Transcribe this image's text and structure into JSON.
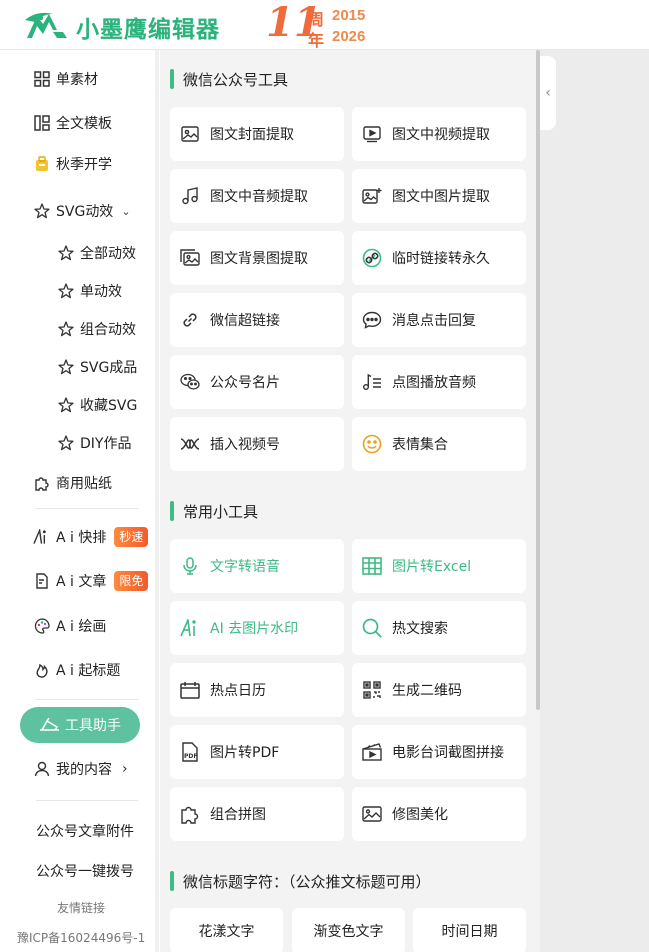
{
  "brand": {
    "name": "小墨鹰编辑器",
    "accent": "#2bb37c"
  },
  "anniversary": {
    "number": "11",
    "zhou": "周",
    "nian": "年",
    "year_start": "2015",
    "year_end": "2026"
  },
  "sidebar": {
    "items": [
      {
        "label": "单素材",
        "icon": "grid-icon"
      },
      {
        "label": "全文模板",
        "icon": "template-icon"
      },
      {
        "label": "秋季开学",
        "icon": "bag-icon"
      },
      {
        "label": "SVG动效",
        "icon": "star-icon"
      }
    ],
    "svg_sub": [
      {
        "label": "全部动效"
      },
      {
        "label": "单动效"
      },
      {
        "label": "组合动效"
      },
      {
        "label": "SVG成品"
      },
      {
        "label": "收藏SVG"
      },
      {
        "label": "DIY作品"
      }
    ],
    "sticker": {
      "label": "商用贴纸"
    },
    "ai_items": [
      {
        "label": "A i 快排",
        "badge": "秒速"
      },
      {
        "label": "A i 文章",
        "badge": "限免"
      },
      {
        "label": "A i 绘画",
        "badge": ""
      },
      {
        "label": "A i 起标题",
        "badge": ""
      }
    ],
    "tool_helper": "工具助手",
    "my_content": "我的内容",
    "attachment": "公众号文章附件",
    "dial": "公众号一键拨号",
    "friend_links": "友情链接",
    "icp": "豫ICP备16024496号-1"
  },
  "main": {
    "section1": {
      "title": "微信公众号工具",
      "cards": [
        {
          "label": "图文封面提取",
          "icon": "image-icon"
        },
        {
          "label": "图文中视频提取",
          "icon": "video-icon"
        },
        {
          "label": "图文中音频提取",
          "icon": "music-icon"
        },
        {
          "label": "图文中图片提取",
          "icon": "image-plus-icon"
        },
        {
          "label": "图文背景图提取",
          "icon": "images-icon"
        },
        {
          "label": "临时链接转永久",
          "icon": "link-circle-icon"
        },
        {
          "label": "微信超链接",
          "icon": "link-icon"
        },
        {
          "label": "消息点击回复",
          "icon": "chat-icon"
        },
        {
          "label": "公众号名片",
          "icon": "wechat-icon"
        },
        {
          "label": "点图播放音频",
          "icon": "music-list-icon"
        },
        {
          "label": "插入视频号",
          "icon": "channels-icon"
        },
        {
          "label": "表情集合",
          "icon": "smile-icon"
        }
      ]
    },
    "section2": {
      "title": "常用小工具",
      "cards": [
        {
          "label": "文字转语音",
          "icon": "mic-icon"
        },
        {
          "label": "图片转Excel",
          "icon": "table-icon"
        },
        {
          "label": "AI 去图片水印",
          "icon": "ai-icon"
        },
        {
          "label": "热文搜索",
          "icon": "search-icon"
        },
        {
          "label": "热点日历",
          "icon": "calendar-icon"
        },
        {
          "label": "生成二维码",
          "icon": "qrcode-icon"
        },
        {
          "label": "图片转PDF",
          "icon": "pdf-icon"
        },
        {
          "label": "电影台词截图拼接",
          "icon": "clapper-icon"
        },
        {
          "label": "组合拼图",
          "icon": "puzzle-icon"
        },
        {
          "label": "修图美化",
          "icon": "photo-icon"
        }
      ]
    },
    "section3": {
      "title": "微信标题字符：（公众推文标题可用）",
      "cards": [
        {
          "label": "花漾文字"
        },
        {
          "label": "渐变色文字"
        },
        {
          "label": "时间日期"
        }
      ]
    }
  }
}
